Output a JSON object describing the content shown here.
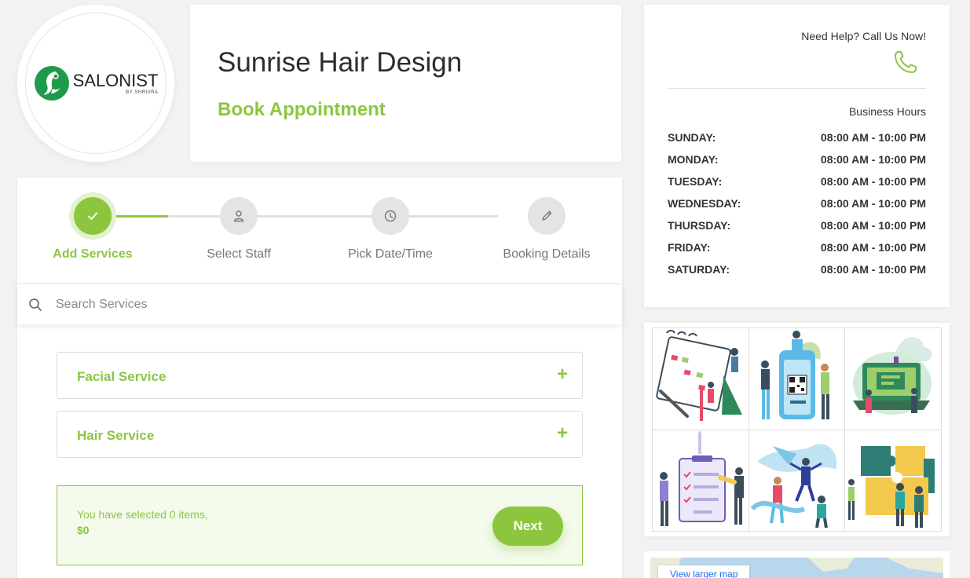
{
  "logo": {
    "name": "SALONIST",
    "sub": "BY SHRIVRA"
  },
  "header": {
    "salon_name": "Sunrise Hair Design",
    "page_title": "Book Appointment"
  },
  "steps": [
    {
      "label": "Add Services",
      "icon": "check-icon",
      "state": "active"
    },
    {
      "label": "Select Staff",
      "icon": "user-icon",
      "state": "pending"
    },
    {
      "label": "Pick Date/Time",
      "icon": "clock-icon",
      "state": "pending"
    },
    {
      "label": "Booking Details",
      "icon": "pencil-icon",
      "state": "pending"
    }
  ],
  "search": {
    "placeholder": "Search Services",
    "value": ""
  },
  "services": [
    {
      "label": "Facial Service",
      "expand_icon": "+"
    },
    {
      "label": "Hair Service",
      "expand_icon": "+"
    }
  ],
  "summary": {
    "text": "You have selected 0 items,",
    "price": "$0",
    "next_label": "Next"
  },
  "help": {
    "text": "Need Help? Call Us Now!",
    "icon": "phone-icon"
  },
  "hours": {
    "title": "Business Hours",
    "rows": [
      {
        "day": "SUNDAY:",
        "time": "08:00 AM - 10:00 PM"
      },
      {
        "day": "MONDAY:",
        "time": "08:00 AM - 10:00 PM"
      },
      {
        "day": "TUESDAY:",
        "time": "08:00 AM - 10:00 PM"
      },
      {
        "day": "WEDNESDAY:",
        "time": "08:00 AM - 10:00 PM"
      },
      {
        "day": "THURSDAY:",
        "time": "08:00 AM - 10:00 PM"
      },
      {
        "day": "FRIDAY:",
        "time": "08:00 AM - 10:00 PM"
      },
      {
        "day": "SATURDAY:",
        "time": "08:00 AM - 10:00 PM"
      }
    ]
  },
  "gallery": [
    "calendar-illustration",
    "qr-phone-illustration",
    "cloud-laptop-illustration",
    "clipboard-checklist-illustration",
    "team-jumping-illustration",
    "puzzle-team-illustration"
  ],
  "map": {
    "link_label": "View larger map"
  },
  "colors": {
    "accent": "#8cc63f",
    "logo_green": "#1e9a4b"
  }
}
